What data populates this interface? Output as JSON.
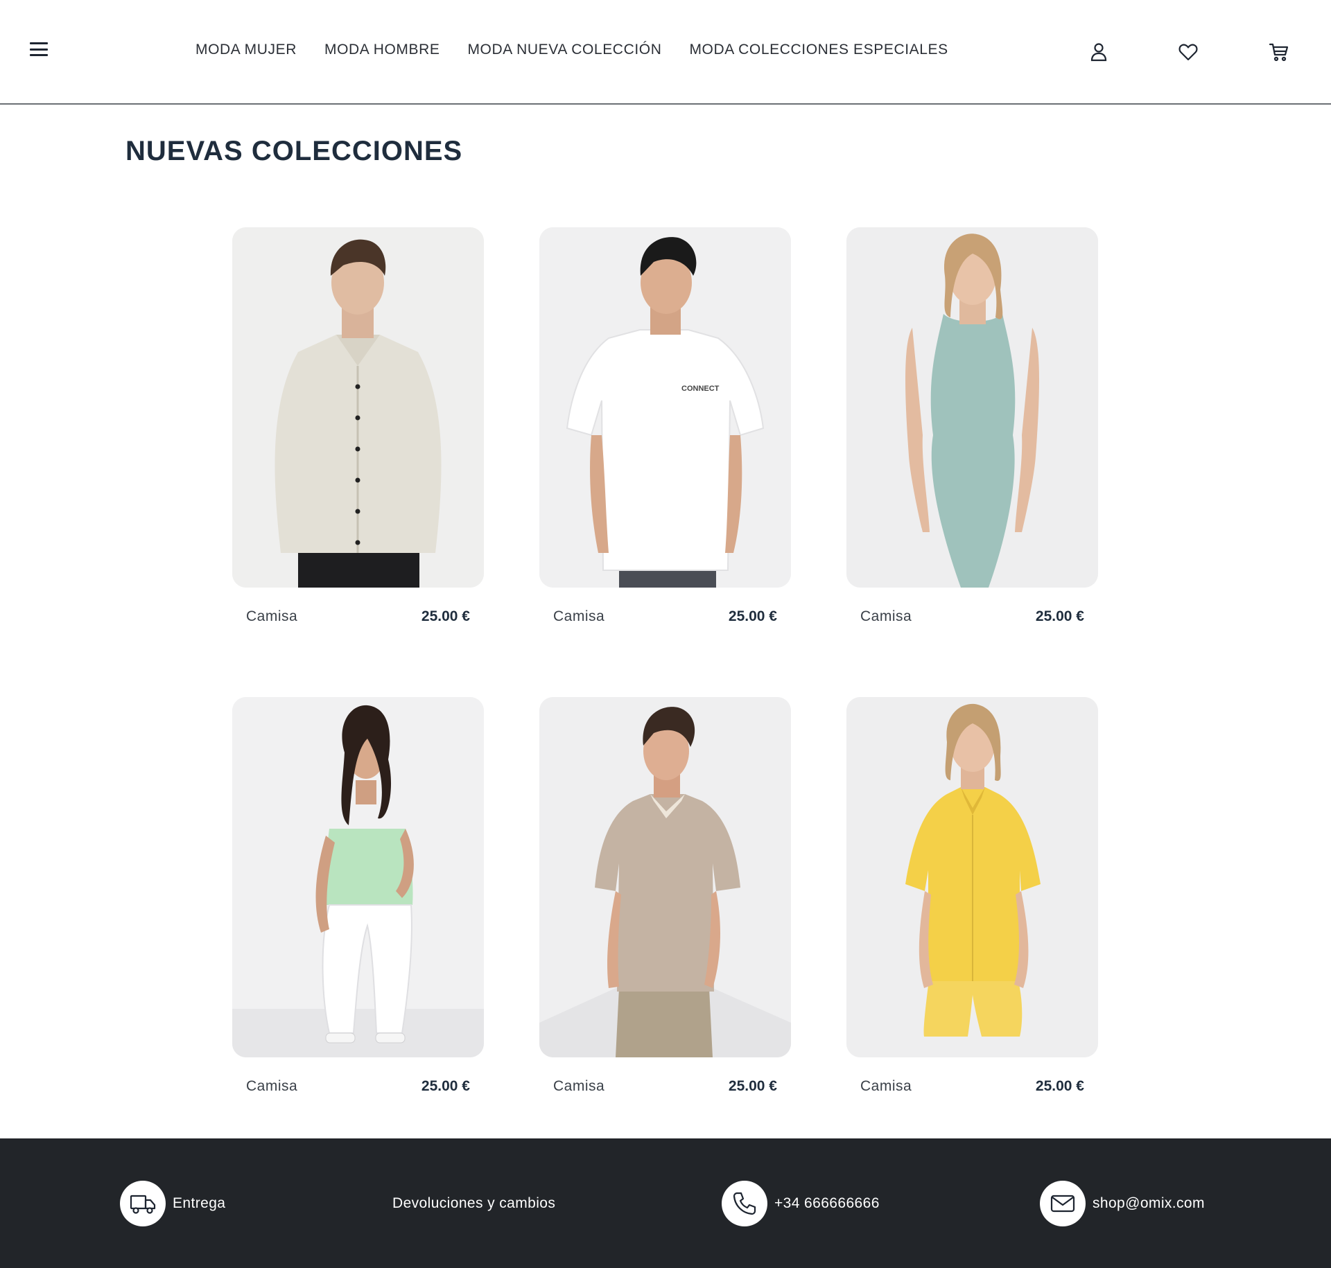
{
  "header": {
    "nav": [
      "MODA MUJER",
      "MODA HOMBRE",
      "MODA NUEVA COLECCIÓN",
      "MODA COLECCIONES ESPECIALES"
    ]
  },
  "main": {
    "title": "NUEVAS COLECCIONES",
    "products": [
      {
        "name": "Camisa",
        "price": "25.00 €"
      },
      {
        "name": "Camisa",
        "price": "25.00 €"
      },
      {
        "name": "Camisa",
        "price": "25.00 €"
      },
      {
        "name": "Camisa",
        "price": "25.00 €"
      },
      {
        "name": "Camisa",
        "price": "25.00 €"
      },
      {
        "name": "Camisa",
        "price": "25.00 €"
      }
    ]
  },
  "footer": {
    "delivery": "Entrega",
    "returns": "Devoluciones y cambios",
    "phone": "+34 666666666",
    "email": "shop@omix.com"
  },
  "colors": {
    "text_dark": "#1f2d3d",
    "footer_bg": "#222529",
    "card_bg": "#eeeeef"
  }
}
